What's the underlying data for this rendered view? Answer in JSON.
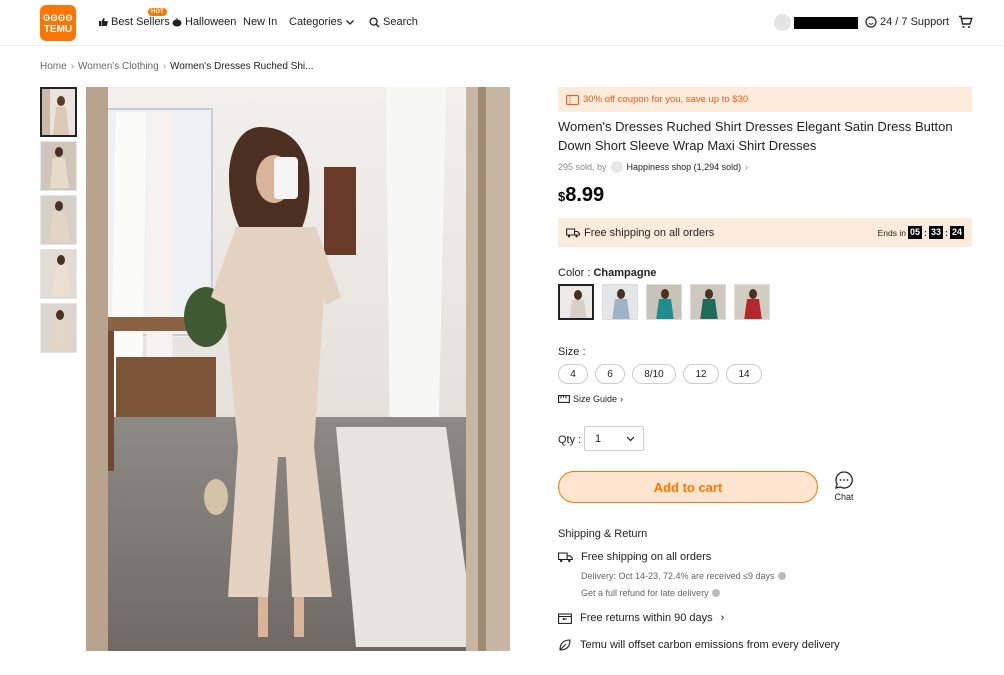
{
  "header": {
    "logo": {
      "line1": "ʘʘʘʘ",
      "line2": "TEMU"
    },
    "nav": {
      "best_sellers": "Best Sellers",
      "hot_badge": "HOT",
      "halloween": "Halloween",
      "new_in": "New In",
      "categories": "Categories",
      "search": "Search"
    },
    "support": "24 / 7 Support"
  },
  "breadcrumb": [
    "Home",
    "Women's Clothing",
    "Women's Dresses Ruched Shi..."
  ],
  "product": {
    "coupon": "30% off coupon for you, save up to $30",
    "title": "Women's Dresses Ruched Shirt Dresses Elegant Satin Dress Button Down Short Sleeve Wrap Maxi Shirt Dresses",
    "sold_prefix": "295 sold, by",
    "shop": "Happiness shop (1,294 sold)",
    "currency": "$",
    "price": "8.99",
    "free_shipping": "Free shipping on all orders",
    "ends_in_label": "Ends in",
    "timer": [
      "05",
      "33",
      "24"
    ],
    "color_label": "Color : ",
    "color_value": "Champagne",
    "swatch_colors": [
      "#d8cfc6",
      "#9fb3c8",
      "#1f8c8f",
      "#1e6b5a",
      "#b3272d"
    ],
    "size_label": "Size :",
    "sizes": [
      "4",
      "6",
      "8/10",
      "12",
      "14"
    ],
    "size_guide": "Size Guide",
    "qty_label": "Qty :",
    "qty_value": "1",
    "add_to_cart": "Add to cart",
    "chat": "Chat"
  },
  "shipping_return": {
    "title": "Shipping & Return",
    "free_shipping": "Free shipping on all orders",
    "delivery": "Delivery: Oct 14-23, 72.4% are received ≤9 days",
    "refund": "Get a full refund for late delivery",
    "returns": "Free returns within 90 days",
    "carbon": "Temu will offset carbon emissions from every delivery"
  },
  "colors": {
    "accent": "#fb7701",
    "coupon_text": "#f05a15",
    "coupon_bg": "#fdecdc"
  }
}
